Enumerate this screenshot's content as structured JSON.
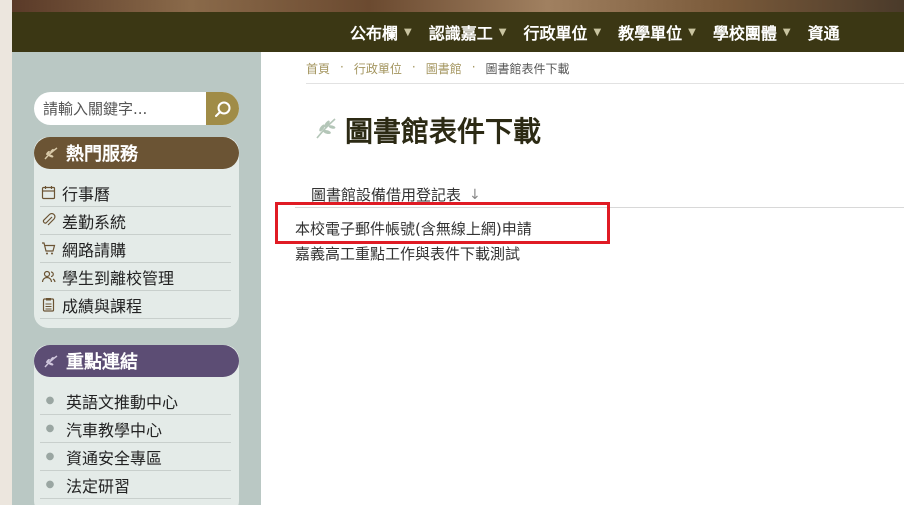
{
  "nav": {
    "items": [
      {
        "label": "公布欄"
      },
      {
        "label": "認識嘉工"
      },
      {
        "label": "行政單位"
      },
      {
        "label": "教學單位"
      },
      {
        "label": "學校團體"
      },
      {
        "label": "資通"
      }
    ]
  },
  "search": {
    "placeholder": "請輸入關鍵字..."
  },
  "hot_services": {
    "title": "熱門服務",
    "items": [
      {
        "label": "行事曆",
        "icon": "calendar-icon"
      },
      {
        "label": "差勤系統",
        "icon": "paperclip-icon"
      },
      {
        "label": "網路請購",
        "icon": "cart-icon"
      },
      {
        "label": "學生到離校管理",
        "icon": "users-icon"
      },
      {
        "label": "成績與課程",
        "icon": "clipboard-icon"
      }
    ]
  },
  "key_links": {
    "title": "重點連結",
    "items": [
      {
        "label": "英語文推動中心"
      },
      {
        "label": "汽車教學中心"
      },
      {
        "label": "資通安全專區"
      },
      {
        "label": "法定研習"
      }
    ]
  },
  "breadcrumb": {
    "items": [
      "首頁",
      "行政單位",
      "圖書館"
    ],
    "current": "圖書館表件下載"
  },
  "page": {
    "title": "圖書館表件下載"
  },
  "table": {
    "header": "圖書館設備借用登記表",
    "rows": [
      {
        "title": "本校電子郵件帳號(含無線上網)申請"
      },
      {
        "title": "嘉義高工重點工作與表件下載測試"
      }
    ]
  },
  "colors": {
    "navbar": "#3b3714",
    "hot_header": "#6b5434",
    "key_header": "#5c4d74",
    "search_button": "#a08c47",
    "highlight": "#e01b24"
  }
}
